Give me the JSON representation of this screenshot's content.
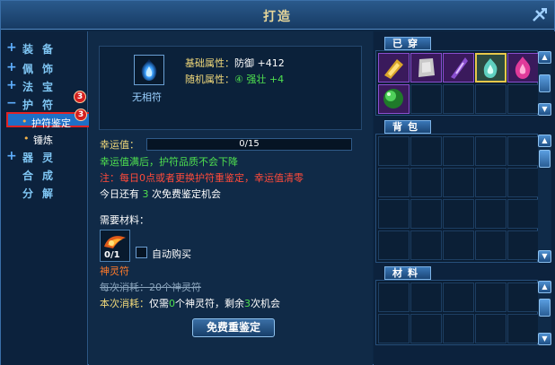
{
  "window": {
    "title": "打造"
  },
  "nav": {
    "items": [
      {
        "sign": "+",
        "label": "装备"
      },
      {
        "sign": "+",
        "label": "佩饰"
      },
      {
        "sign": "+",
        "label": "法宝"
      },
      {
        "sign": "−",
        "label": "护符",
        "badge": "3"
      },
      {
        "sign": "+",
        "label": "器灵"
      },
      {
        "sign": "",
        "label": "合成"
      },
      {
        "sign": "",
        "label": "分解"
      }
    ],
    "subitems": [
      {
        "label": "护符鉴定",
        "badge": "3",
        "active": true
      },
      {
        "label": "锤炼",
        "active": false
      }
    ]
  },
  "item": {
    "name": "无相符",
    "base_attr_label": "基础属性：",
    "base_attr_value": "防御 +412",
    "random_attr_label": "随机属性：",
    "random_attr_level": "④",
    "random_attr_name": "强壮",
    "random_attr_value": "+4"
  },
  "luck": {
    "label": "幸运值：",
    "value_text": "0/15",
    "hint_full": "幸运值满后，护符品质不会下降",
    "warning": "注：每日0点或者更换护符重鉴定，幸运值清零",
    "free_prefix": "今日还有",
    "free_count": "3",
    "free_suffix": "次免费鉴定机会"
  },
  "materials": {
    "label": "需要材料：",
    "slot_count": "0/1",
    "auto_buy_label": "自动购买",
    "item_name": "神灵符",
    "per_cost": "每次消耗：20个神灵符",
    "this_cost_label": "本次消耗：",
    "this_cost_prefix": "仅需",
    "this_cost_amount": "0",
    "this_cost_unit": "个神灵符，剩余",
    "this_cost_remaining": "3",
    "this_cost_suffix": "次机会"
  },
  "button": {
    "label": "免费重鉴定"
  },
  "right_panel": {
    "equipped_tab": "已穿",
    "bag_tab": "背包",
    "materials_tab": "材料"
  },
  "colors": {
    "accent": "#f0d87a",
    "positive": "#4fe04f",
    "warning": "#ff4a3a",
    "highlight": "#1e6fc6"
  },
  "equipped_items": [
    {
      "icon": "golden-talisman-icon",
      "color": "#d9a52a",
      "selected": false
    },
    {
      "icon": "stone-tablet-icon",
      "color": "#c9c9c9",
      "selected": false
    },
    {
      "icon": "purple-scroll-icon",
      "color": "#8a4fd0",
      "selected": false
    },
    {
      "icon": "cyan-flame-icon",
      "color": "#5fd0c0",
      "selected": true
    },
    {
      "icon": "pink-flame-icon",
      "color": "#e03a9a",
      "selected": false
    },
    {
      "icon": "green-orb-icon",
      "color": "#2fae3a",
      "selected": false
    }
  ]
}
